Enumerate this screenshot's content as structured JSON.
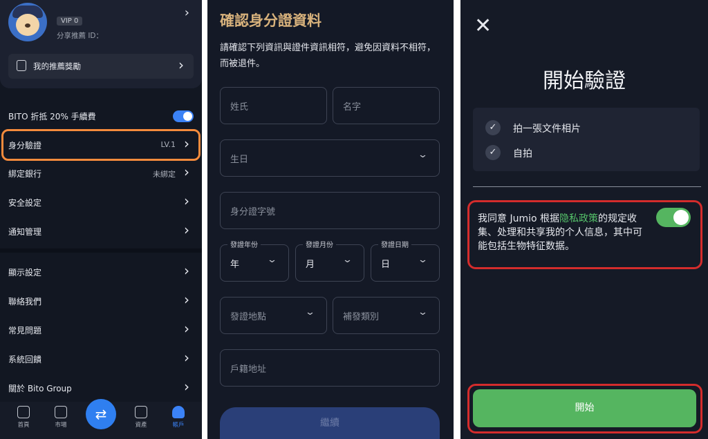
{
  "panel1": {
    "vip": "VIP 0",
    "referral_id_label": "分享推薦 ID：",
    "reward_label": "我的推薦獎勵",
    "rows": [
      {
        "label": "BITO 折抵 20% 手續費",
        "value": "",
        "toggle": true
      },
      {
        "label": "身分驗證",
        "value": "LV.1"
      },
      {
        "label": "綁定銀行",
        "value": "未綁定"
      },
      {
        "label": "安全設定",
        "value": ""
      },
      {
        "label": "通知管理",
        "value": ""
      },
      {
        "label": "顯示設定",
        "value": ""
      },
      {
        "label": "聯絡我們",
        "value": ""
      },
      {
        "label": "常見問題",
        "value": ""
      },
      {
        "label": "系統回饋",
        "value": ""
      },
      {
        "label": "關於 Bito Group",
        "value": ""
      }
    ],
    "tabs": [
      "首頁",
      "市場",
      "資產",
      "帳戶"
    ],
    "accent": "#3b82f6",
    "highlight_color": "#f58b3c"
  },
  "panel2": {
    "title": "確認身分證資料",
    "description": "請確認下列資訊與證件資訊相符，避免因資料不相符，而被退件。",
    "fields": {
      "last_name": "姓氏",
      "first_name": "名字",
      "birthday": "生日",
      "id_number": "身分證字號",
      "issue_year_label": "發證年份",
      "issue_year_value": "年",
      "issue_month_label": "發證月份",
      "issue_month_value": "月",
      "issue_day_label": "發證日期",
      "issue_day_value": "日",
      "issue_place": "發證地點",
      "reissue_type": "補發類別",
      "household_address": "戶籍地址"
    },
    "continue_label": "繼續",
    "title_color": "#d8b27c"
  },
  "panel3": {
    "title": "開始驗證",
    "checklist": [
      "拍一張文件相片",
      "自拍"
    ],
    "consent_prefix": "我同意 Jumio 根据",
    "consent_link": "隐私政策",
    "consent_suffix": "的规定收集、处理和共享我的个人信息，其中可能包括生物特征数据。",
    "start_label": "開始",
    "green": "#55b560",
    "highlight_color": "#d42c2c"
  }
}
